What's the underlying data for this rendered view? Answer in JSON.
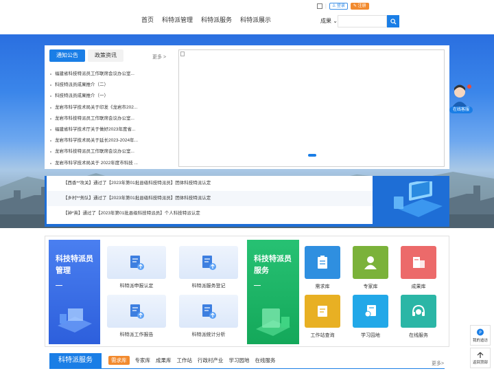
{
  "header": {
    "nav": [
      "首页",
      "科特派管理",
      "科特派服务",
      "科特派展示"
    ],
    "login": "登录",
    "register": "注册",
    "search": {
      "category": "成果",
      "placeholder": ""
    }
  },
  "notice": {
    "tabs": [
      "通知公告",
      "政策资讯"
    ],
    "more": "更多 >",
    "items": [
      "福建省科技特派员工作联席会议办公室...",
      "科技特派员成果推介（二）",
      "科技特派员成果推介（一）",
      "龙岩市科学技术局关于印发《龙岩市202...",
      "龙岩市科技特派员工作联席会议办公室...",
      "福建省科学技术厅关于做好2023年度省...",
      "龙岩市科学技术局关于延长2023-2024年...",
      "龙岩市科技特派员工作联席会议办公室...",
      "龙岩市科学技术局关于 2022年度市科技 ..."
    ]
  },
  "ticker": [
    "【西香**攻关】通过了【2023年第01批县级科技特派员】团体科技特派认定",
    "【乡村**务队】通过了【2023年第01批县级科技特派员】团体科技特派认定",
    "【钟*英】通过了【2023年第01批县级科技特派员】个人科技特派认定"
  ],
  "customer_service": "在线客服",
  "management": {
    "title": "科技特派员管理",
    "tiles": [
      "科特派申报认定",
      "科特派服务登记",
      "科特派工作报告",
      "科特派统计分析"
    ]
  },
  "service": {
    "title": "科技特派员服务",
    "items": [
      {
        "label": "需求库",
        "color": "#2f8fe0"
      },
      {
        "label": "专家库",
        "color": "#7bb23a"
      },
      {
        "label": "成果库",
        "color": "#ec6a6a"
      },
      {
        "label": "工作站查询",
        "color": "#e8b023"
      },
      {
        "label": "学习园地",
        "color": "#22a8e8"
      },
      {
        "label": "在线服务",
        "color": "#2bb6a6"
      }
    ]
  },
  "bottom": {
    "title": "科特派服务",
    "tabs": [
      "需求库",
      "专家库",
      "成果库",
      "工作站",
      "行政村产业",
      "学习园地",
      "在线服务"
    ],
    "more": "更多>"
  },
  "fixed": {
    "advice": "我的追访",
    "top": "返回顶部"
  }
}
